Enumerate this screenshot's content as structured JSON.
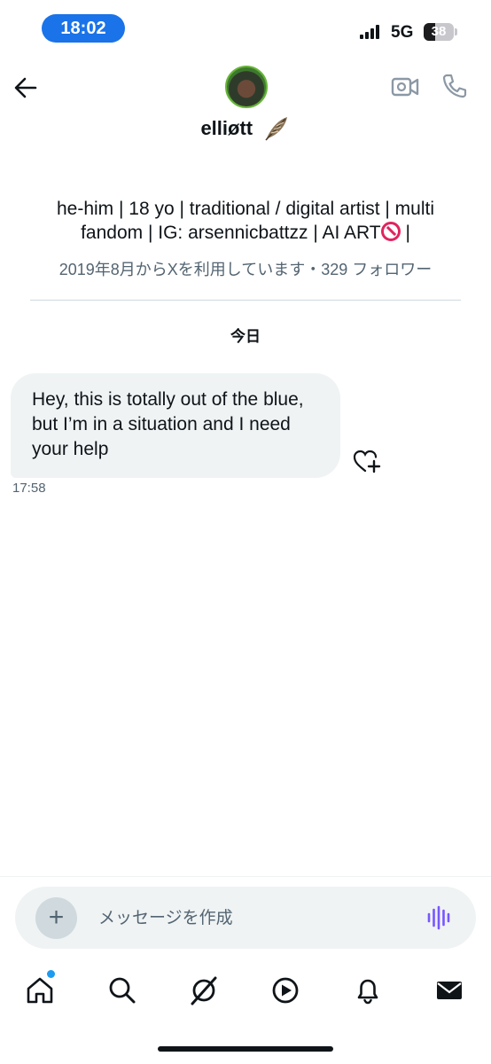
{
  "status_bar": {
    "time": "18:02",
    "network": "5G",
    "battery": "38",
    "battery_level": 0.38
  },
  "header": {
    "name": "elliøtt",
    "emoji_icon": "feather-icon"
  },
  "profile": {
    "bio_prefix": "he-him | 18 yo | traditional / digital artist | multi fandom | IG: arsennicbattzz | AI ART",
    "bio_suffix": " |",
    "joined": "2019年8月からXを利用しています・329 フォロワー"
  },
  "conversation": {
    "date_label": "今日",
    "messages": [
      {
        "text": "Hey, this is totally out of the blue, but I’m in a situation and I need your help",
        "time": "17:58"
      }
    ]
  },
  "composer": {
    "placeholder": "メッセージを作成",
    "plus_label": "+"
  },
  "colors": {
    "accent": "#1d9bf0",
    "time_pill": "#1a73e8",
    "voice": "#7856ff",
    "bubble": "#eff3f4"
  },
  "tabs": [
    "home-icon",
    "search-icon",
    "grok-icon",
    "video-icon",
    "notifications-icon",
    "messages-icon"
  ]
}
